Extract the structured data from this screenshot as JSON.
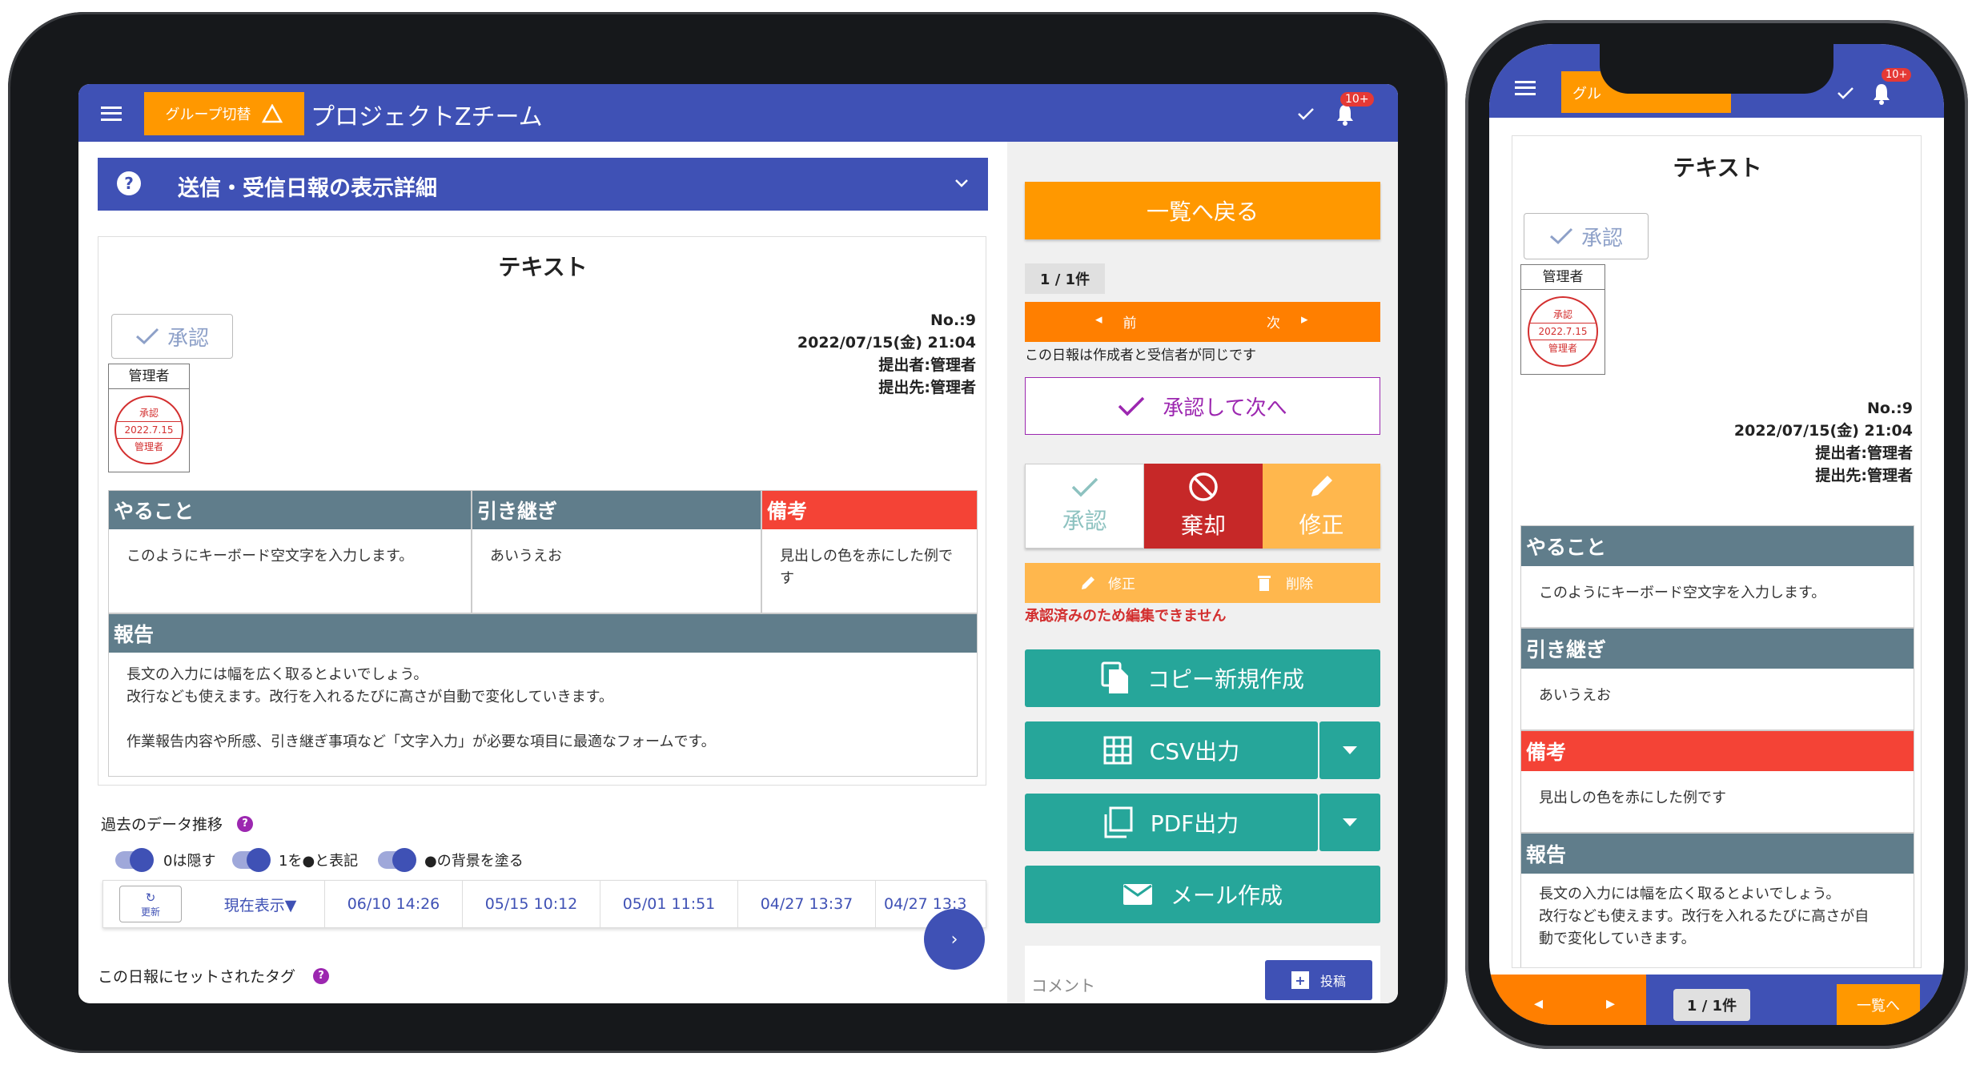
{
  "tablet": {
    "header": {
      "group_switch": "グループ切替",
      "team_name": "プロジェクトZチーム",
      "badge": "10+"
    },
    "section_title": "送信・受信日報の表示詳細",
    "report": {
      "title": "テキスト",
      "approve_label": "承認",
      "stamp_owner": "管理者",
      "stamp_lines": [
        "承認",
        "2022.7.15",
        "管理者"
      ],
      "number": "No.:9",
      "datetime": "2022/07/15(金) 21:04",
      "submitter": "提出者:管理者",
      "recipient": "提出先:管理者",
      "fields": [
        {
          "label": "やること",
          "value": "このようにキーボード空文字を入力します。"
        },
        {
          "label": "引き継ぎ",
          "value": "あいうえお"
        },
        {
          "label": "備考",
          "value": "見出しの色を赤にした例です"
        }
      ],
      "report_label": "報告",
      "report_lines": [
        "長文の入力には幅を広く取るとよいでしょう。",
        "改行なども使えます。改行を入れるたびに高さが自動で変化していきます。",
        "",
        "作業報告内容や所感、引き継ぎ事項など「文字入力」が必要な項目に最適なフォームです。"
      ]
    },
    "history": {
      "title": "過去のデータ推移",
      "toggles": [
        "0は隠す",
        "1を●と表記",
        "●の背景を塗る"
      ],
      "refresh": "更新",
      "current": "現在表示▼",
      "dates": [
        "06/10 14:26",
        "05/15 10:12",
        "05/01 11:51",
        "04/27 13:37",
        "04/27 13:3"
      ]
    },
    "tags_label": "この日報にセットされたタグ",
    "side": {
      "back": "一覧へ戻る",
      "count": "1 / 1件",
      "prev": "前",
      "next": "次",
      "same_note": "この日報は作成者と受信者が同じです",
      "approve_next": "承認して次へ",
      "approve": "承認",
      "reject": "棄却",
      "revise": "修正",
      "edit": "修正",
      "delete": "削除",
      "locked_note": "承認済みのため編集できません",
      "copy_new": "コピー新規作成",
      "csv": "CSV出力",
      "pdf": "PDF出力",
      "mail": "メール作成",
      "comment": "コメント",
      "post": "投稿"
    }
  },
  "phone": {
    "group_partial": "グル",
    "badge": "10+",
    "title": "テキスト",
    "approve_label": "承認",
    "stamp_owner": "管理者",
    "stamp_lines": [
      "承認",
      "2022.7.15",
      "管理者"
    ],
    "number": "No.:9",
    "datetime": "2022/07/15(金) 21:04",
    "submitter": "提出者:管理者",
    "recipient": "提出先:管理者",
    "fields": [
      {
        "label": "やること",
        "value": "このようにキーボード空文字を入力します。"
      },
      {
        "label": "引き継ぎ",
        "value": "あいうえお"
      },
      {
        "label": "備考",
        "value": "見出しの色を赤にした例です"
      }
    ],
    "report_label": "報告",
    "report_lines": [
      "長文の入力には幅を広く取るとよいでしょう。",
      "改行なども使えます。改行を入れるたびに高さが自",
      "動で変化していきます。"
    ],
    "count": "1 / 1件",
    "back": "一覧へ"
  },
  "colors": {
    "primary": "#3f51b5",
    "accent": "#ff9800",
    "teal": "#26a69a",
    "reject": "#c62828",
    "danger": "#f44336",
    "header_gray": "#607d8b"
  }
}
